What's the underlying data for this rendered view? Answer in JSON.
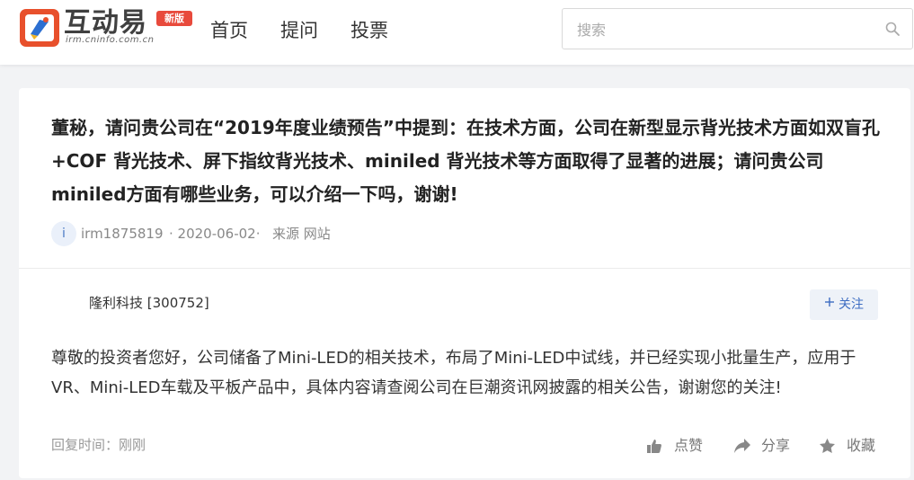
{
  "header": {
    "brand_name": "互动易",
    "brand_sub": "irm.cninfo.com.cn",
    "badge": "新版",
    "nav": [
      "首页",
      "提问",
      "投票"
    ],
    "search_placeholder": "搜索"
  },
  "question": {
    "text": "董秘，请问贵公司在“2019年度业绩预告”中提到：在技术方面，公司在新型显示背光技术方面如双盲孔+COF 背光技术、屏下指纹背光技术、miniled 背光技术等方面取得了显著的进展；请问贵公司miniled方面有哪些业务，可以介绍一下吗，谢谢!",
    "avatar_letter": "i",
    "user": "irm1875819",
    "date": "· 2020-06-02·",
    "source": "来源 网站"
  },
  "answer": {
    "company": "隆利科技 [300752]",
    "follow_label": "关注",
    "text": "尊敬的投资者您好，公司储备了Mini-LED的相关技术，布局了Mini-LED中试线，并已经实现小批量生产，应用于VR、Mini-LED车载及平板产品中，具体内容请查阅公司在巨潮资讯网披露的相关公告，谢谢您的关注!",
    "reply_time": "回复时间：刚刚",
    "actions": {
      "like": "点赞",
      "share": "分享",
      "collect": "收藏"
    }
  },
  "colors": {
    "brand_orange": "#e8502c",
    "badge_red": "#e84a3c",
    "follow_blue": "#3d6dc2"
  },
  "icons": [
    "logo-icon",
    "search-icon",
    "plus-icon",
    "thumbs-up-icon",
    "share-icon",
    "star-icon"
  ]
}
